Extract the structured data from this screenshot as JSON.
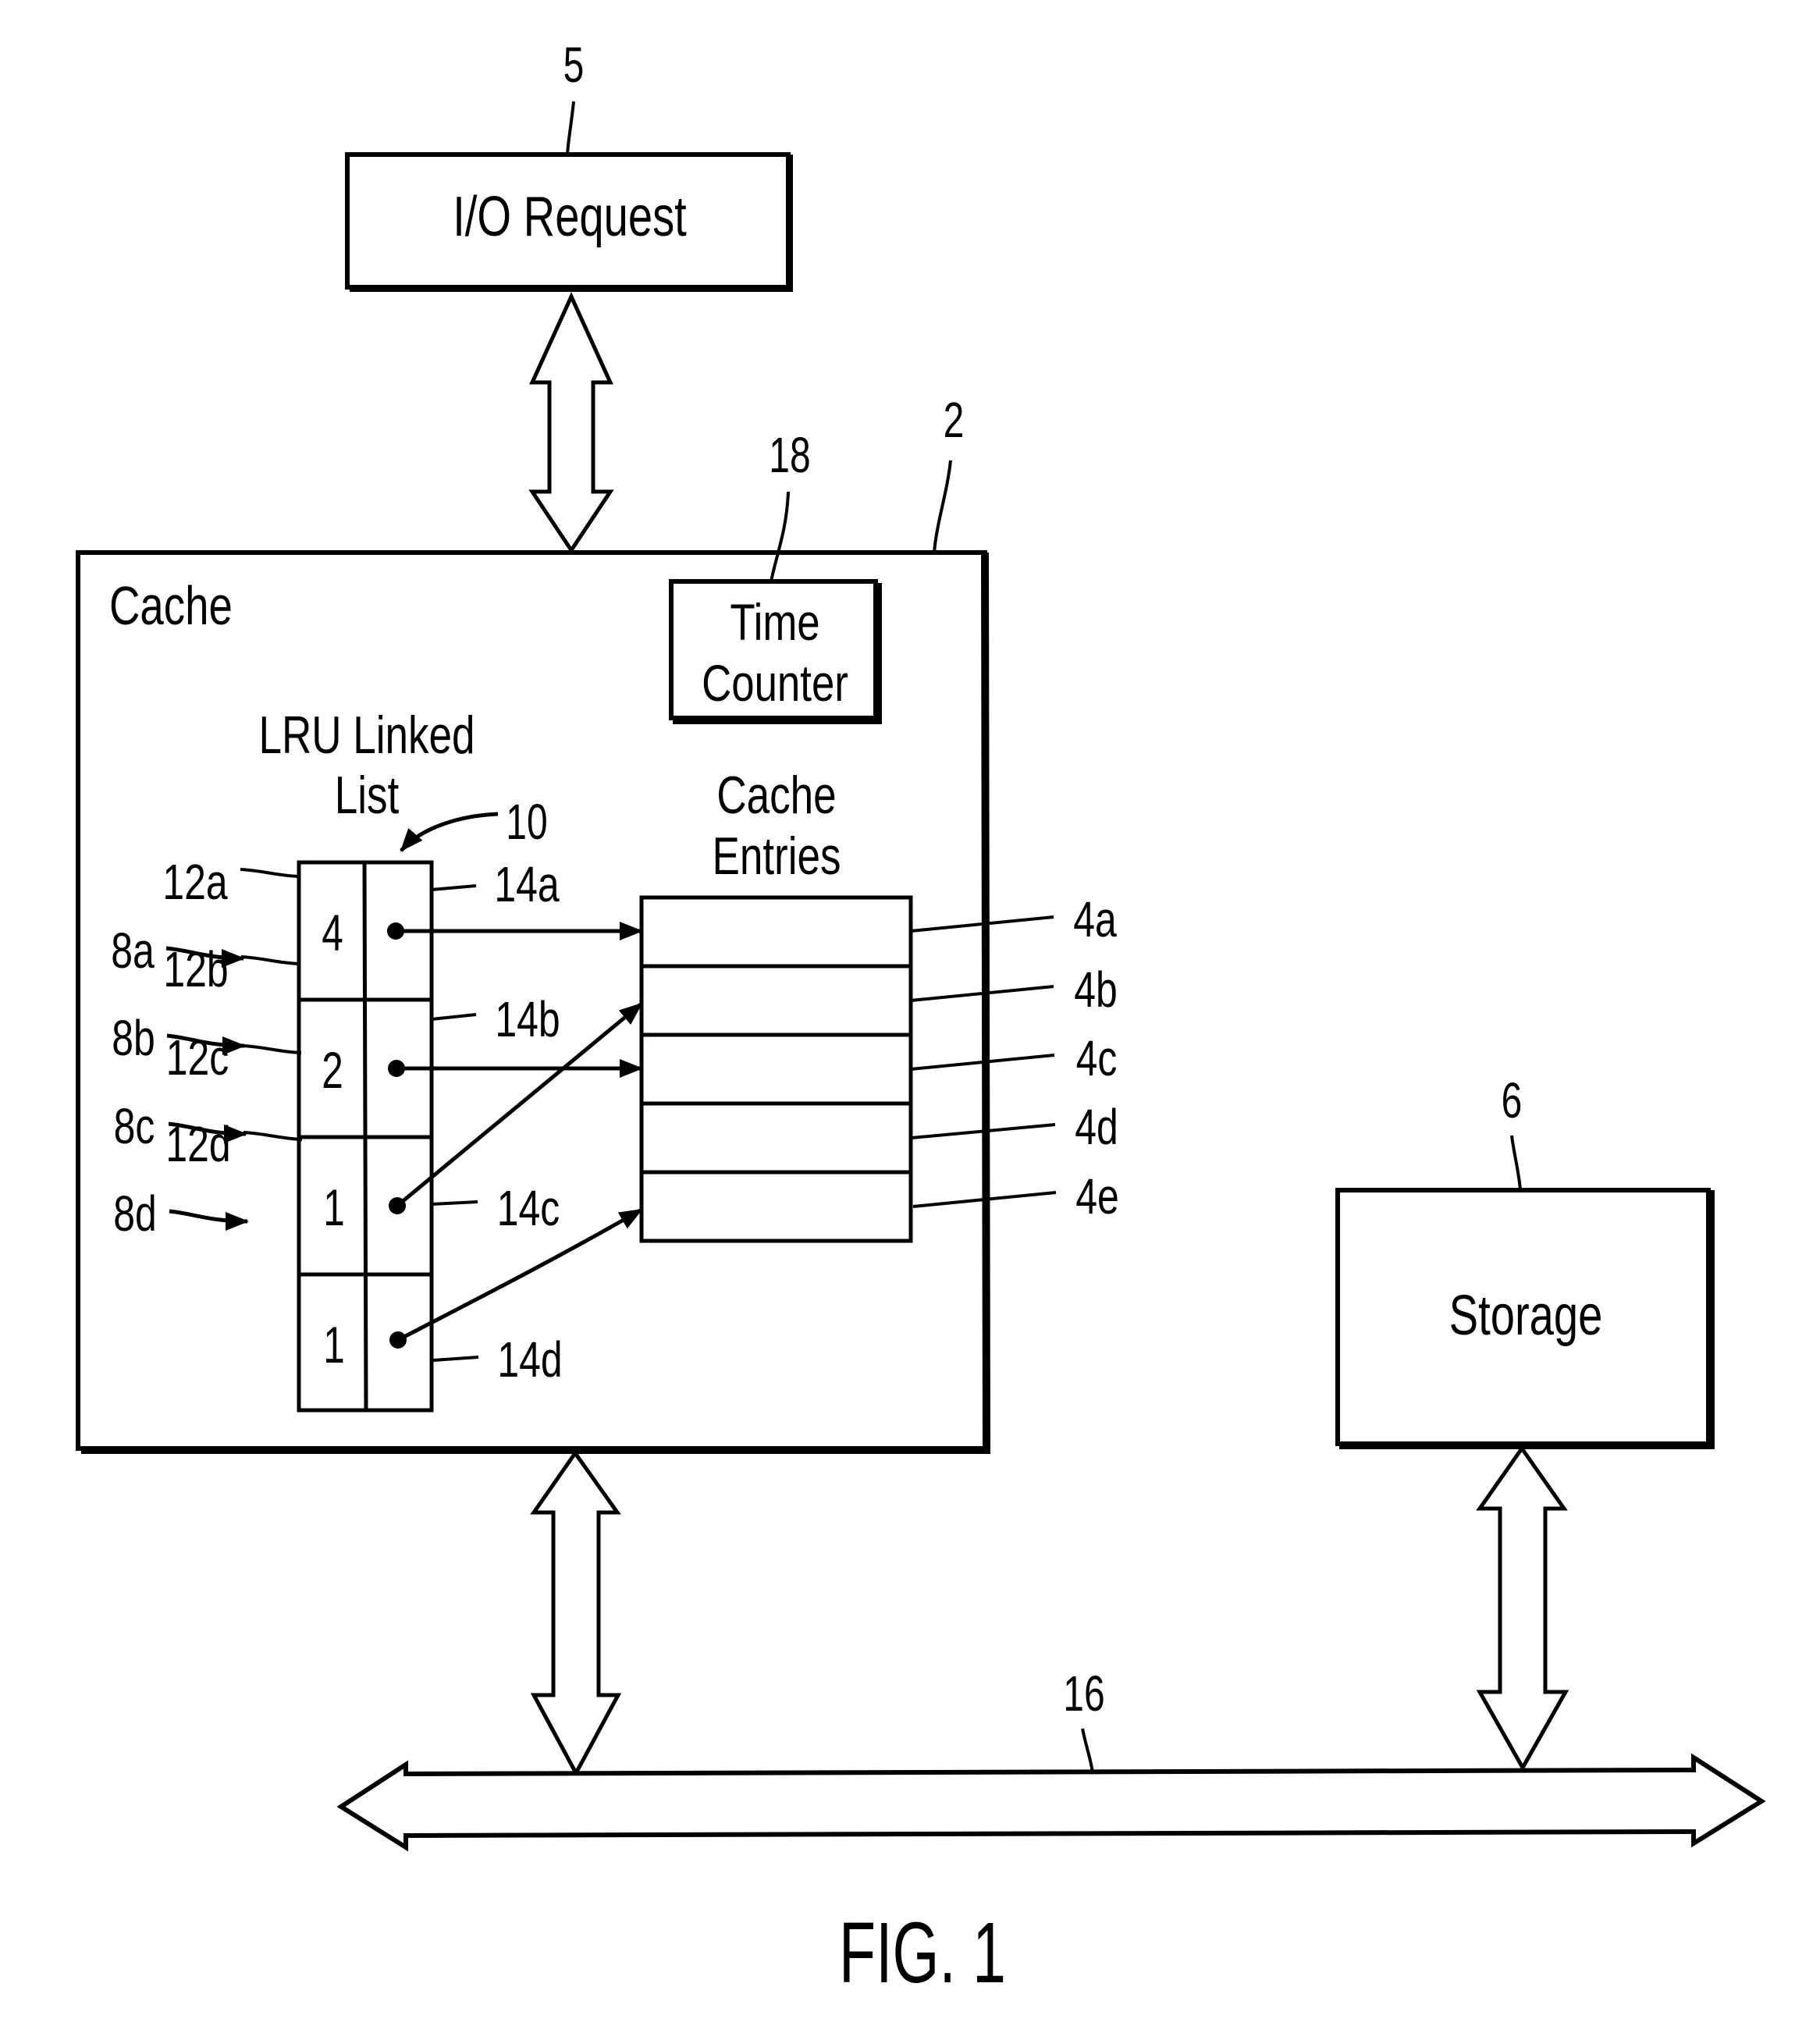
{
  "figure": {
    "caption": "FIG. 1",
    "line_color": "#000000",
    "background": "#ffffff"
  },
  "io_request": {
    "label": "I/O Request",
    "ref": "5"
  },
  "cache": {
    "label": "Cache",
    "ref": "2",
    "time_counter": {
      "line1": "Time",
      "line2": "Counter",
      "ref": "18"
    },
    "lru_list": {
      "title_line1": "LRU Linked",
      "title_line2": "List",
      "ref": "10",
      "entries": [
        {
          "value": "4",
          "entry_ref": "12a",
          "pointer_ref": "14a",
          "input_ref": "8a",
          "points_to": "4a"
        },
        {
          "value": "2",
          "entry_ref": "12b",
          "pointer_ref": "14b",
          "input_ref": "8b",
          "points_to": "4c"
        },
        {
          "value": "1",
          "entry_ref": "12c",
          "pointer_ref": "14c",
          "input_ref": "8c",
          "points_to": "4b"
        },
        {
          "value": "1",
          "entry_ref": "12d",
          "pointer_ref": "14d",
          "input_ref": "8d",
          "points_to": "4e"
        }
      ]
    },
    "cache_entries": {
      "title_line1": "Cache",
      "title_line2": "Entries",
      "refs": [
        "4a",
        "4b",
        "4c",
        "4d",
        "4e"
      ]
    }
  },
  "storage": {
    "label": "Storage",
    "ref": "6"
  },
  "bus": {
    "ref": "16"
  }
}
